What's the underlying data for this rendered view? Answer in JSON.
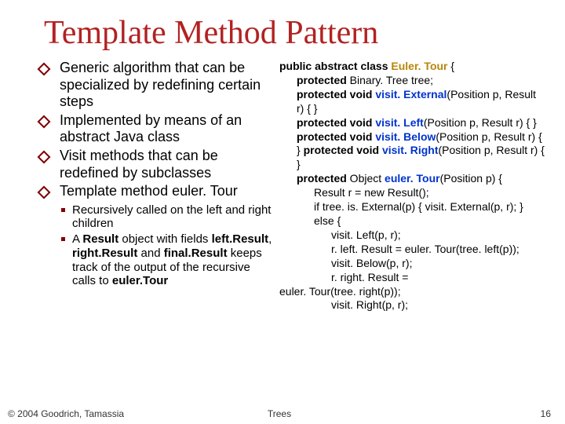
{
  "title": "Template Method Pattern",
  "bullets": [
    "Generic algorithm that can be specialized by redefining certain steps",
    "Implemented by means of an abstract Java class",
    "Visit methods that can be redefined by subclasses",
    "Template method euler. Tour"
  ],
  "sub_bullets": [
    "Recursively called on the left and right children",
    "A Result object with fields left.Result, right.Result and final.Result keeps track of the output of the recursive calls to euler.Tour"
  ],
  "code": {
    "l1a": "public abstract class ",
    "l1b": "Euler. Tour",
    "l1c": " {",
    "l2a": "protected",
    "l2b": " Binary. Tree tree;",
    "l3a": "protected void ",
    "l3b": "visit. External",
    "l3c": "(Position p, Result r) { }",
    "l4a": "protected void ",
    "l4b": "visit. Left",
    "l4c": "(Position p, Result r) { }",
    "l5a": "protected void ",
    "l5b": "visit. Below",
    "l5c": "(Position p, Result r) { }   ",
    "l5d": "protected void ",
    "l5e": "visit. Right",
    "l5f": "(Position p, Result r) { }",
    "l6a": "protected",
    "l6b": " Object ",
    "l6c": "euler. Tour",
    "l6d": "(Position p) {",
    "l7": "Result r = new Result();",
    "l8": "if tree. is. External(p) { visit. External(p, r); }",
    "l9": "else {",
    "l10": "visit. Left(p, r);",
    "l11": "r. left. Result = euler. Tour(tree. left(p));",
    "l12": "visit. Below(p, r);",
    "l13": "r. right. Result =",
    "l14": "euler. Tour(tree. right(p));",
    "l15": "visit. Right(p, r);"
  },
  "footer": {
    "left": "© 2004 Goodrich, Tamassia",
    "center": "Trees",
    "right": "16"
  }
}
